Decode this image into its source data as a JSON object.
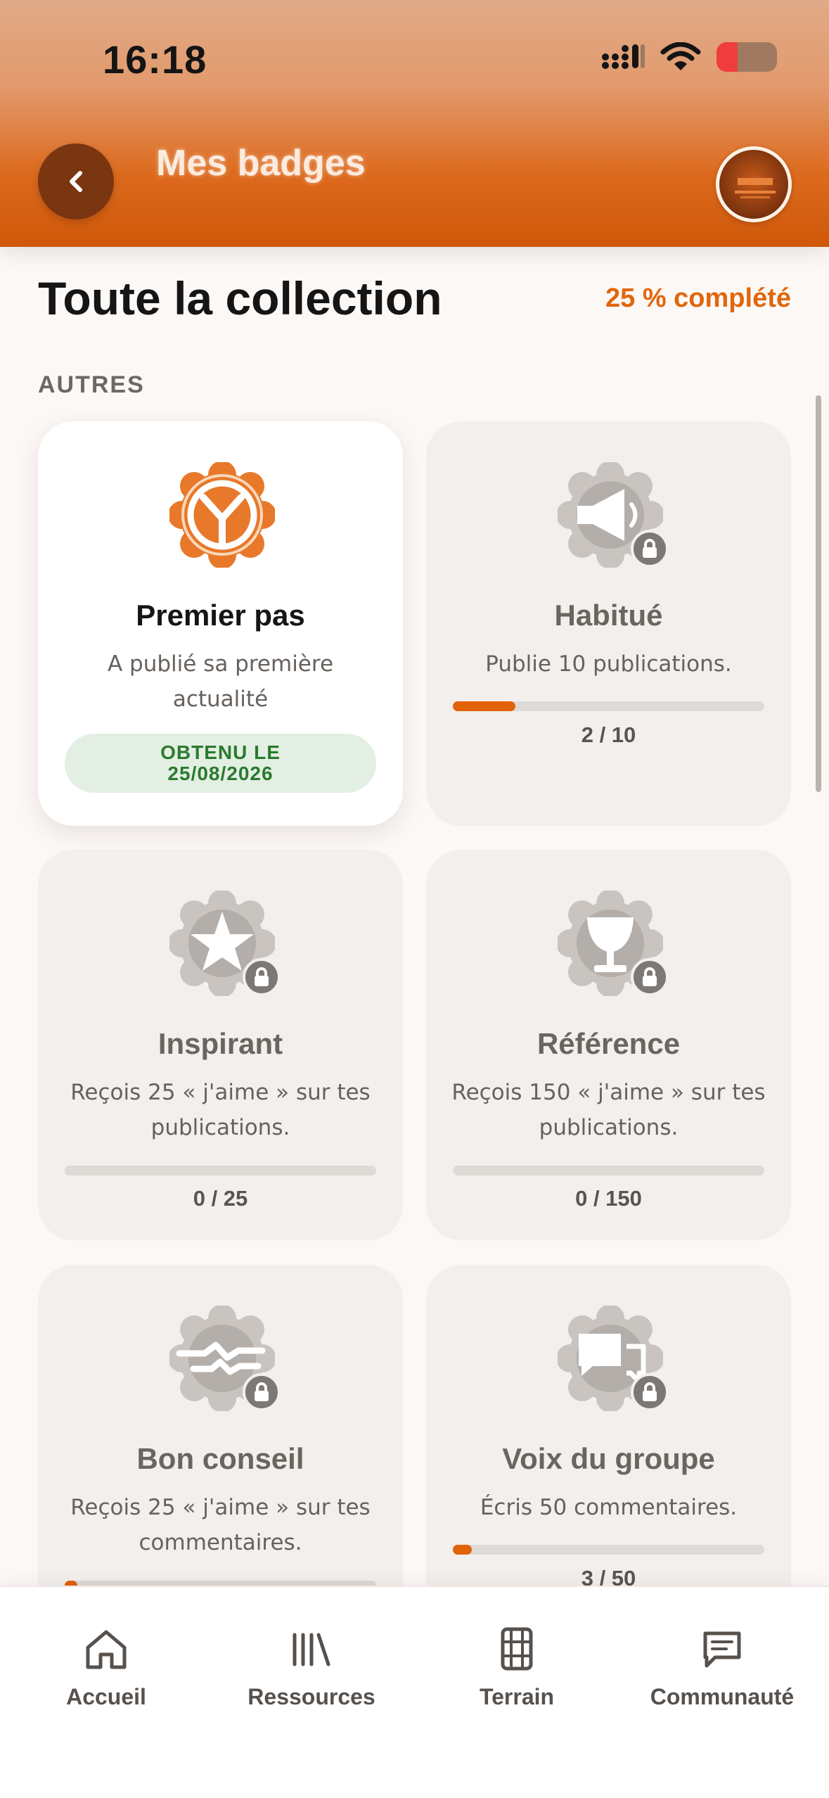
{
  "status_bar": {
    "time": "16:18"
  },
  "header": {
    "title": "Mes badges",
    "back_icon": "chevron-left-icon",
    "avatar_icon": "profile-avatar"
  },
  "collection": {
    "title": "Toute la collection",
    "completion": "25 % complété"
  },
  "category": {
    "label": "AUTRES"
  },
  "badges": [
    {
      "title": "Premier pas",
      "description": "A publié sa première actualité",
      "obtained_line1": "OBTENU LE",
      "obtained_line2": "25/08/2026",
      "icon": "y-logo-icon",
      "status": "unlocked"
    },
    {
      "title": "Habitué",
      "description": "Publie 10 publications.",
      "progress_text": "2 / 10",
      "progress": 0.2,
      "icon": "megaphone-icon",
      "status": "locked"
    },
    {
      "title": "Inspirant",
      "description": "Reçois 25 « j'aime » sur tes publications.",
      "progress_text": "0 / 25",
      "progress": 0,
      "icon": "star-icon",
      "status": "locked"
    },
    {
      "title": "Référence",
      "description": "Reçois 150 « j'aime » sur tes publications.",
      "progress_text": "0 / 150",
      "progress": 0,
      "icon": "trophy-icon",
      "status": "locked"
    },
    {
      "title": "Bon conseil",
      "description": "Reçois 25 « j'aime » sur tes commentaires.",
      "progress": 0.04,
      "icon": "handshake-icon",
      "status": "locked"
    },
    {
      "title": "Voix du groupe",
      "description": "Écris 50 commentaires.",
      "progress_text": "3 / 50",
      "progress": 0.06,
      "icon": "chat-bubbles-icon",
      "status": "locked"
    }
  ],
  "nav": [
    {
      "label": "Accueil",
      "icon": "home-icon"
    },
    {
      "label": "Ressources",
      "icon": "library-icon"
    },
    {
      "label": "Terrain",
      "icon": "terrain-icon"
    },
    {
      "label": "Communauté",
      "icon": "message-icon"
    }
  ],
  "colors": {
    "accent": "#e2620a",
    "header_top": "#e0a987",
    "header_bottom": "#cf5708",
    "success": "#2b7a2f"
  }
}
